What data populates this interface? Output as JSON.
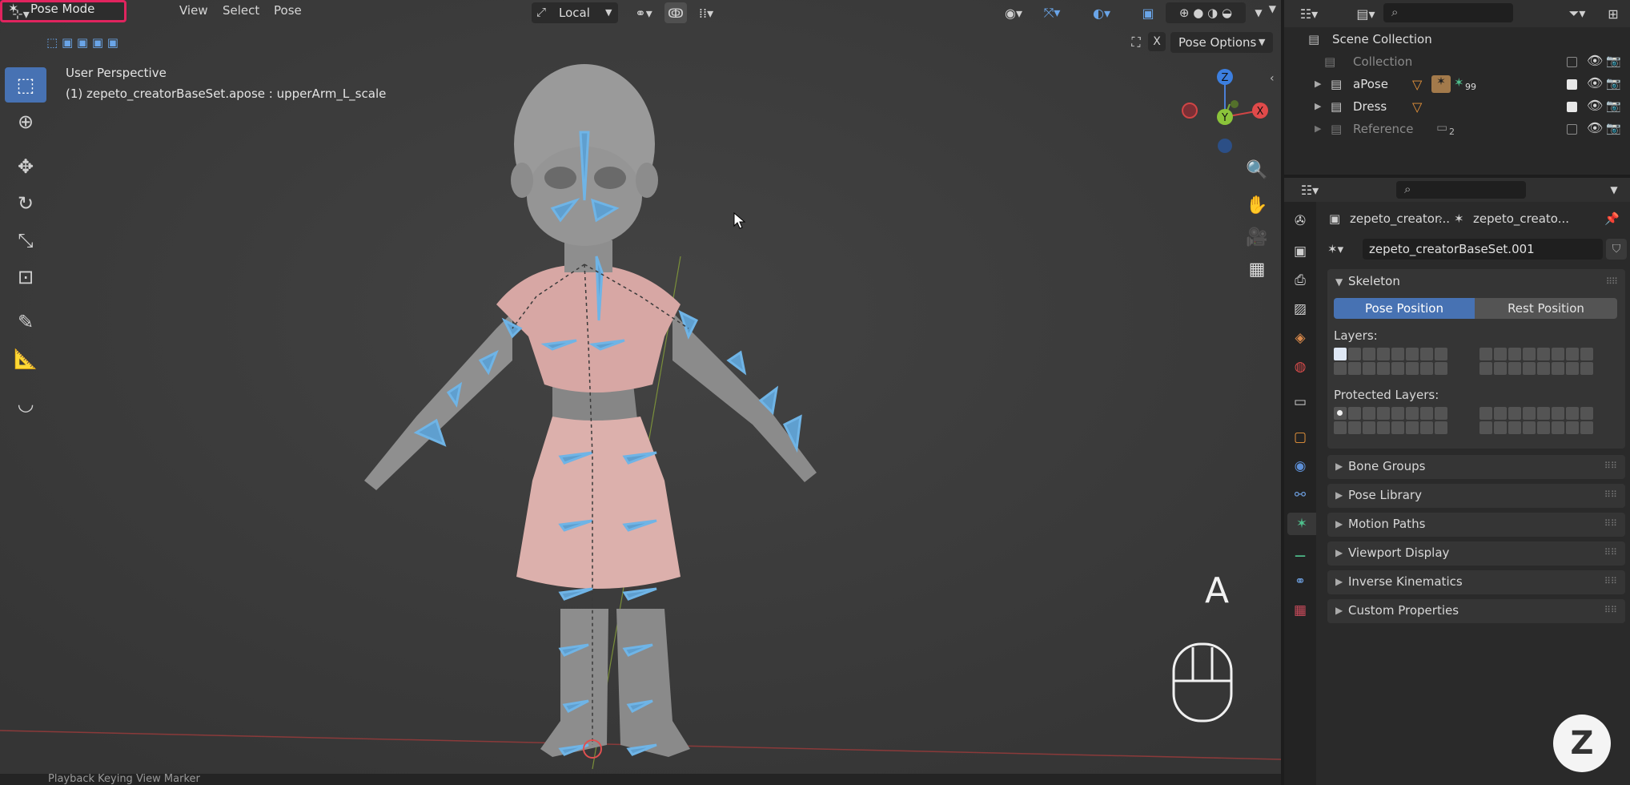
{
  "viewport": {
    "mode": "Pose Mode",
    "menus": [
      "View",
      "Select",
      "Pose"
    ],
    "orientation": "Local",
    "pose_options_label": "Pose Options",
    "close_x": "X",
    "info_line1": "User Perspective",
    "info_line2": "(1) zepeto_creatorBaseSet.apose : upperArm_L_scale",
    "gizmo": {
      "z": "Z",
      "y": "Y",
      "x": "X"
    },
    "key_overlay": "A",
    "timeline_text": "Playback    Keying    View    Marker"
  },
  "outliner": {
    "items": [
      {
        "name": "Scene Collection",
        "level": 0,
        "dim": false,
        "checkbox": false,
        "visible": false
      },
      {
        "name": "Collection",
        "level": 1,
        "dim": true,
        "checkbox": true,
        "checked": false
      },
      {
        "name": "aPose",
        "level": 1,
        "dim": false,
        "checkbox": true,
        "checked": true,
        "badge": "99"
      },
      {
        "name": "Dress",
        "level": 1,
        "dim": false,
        "checkbox": true,
        "checked": true
      },
      {
        "name": "Reference",
        "level": 1,
        "dim": true,
        "checkbox": true,
        "checked": false,
        "badge": "2"
      }
    ]
  },
  "properties": {
    "breadcrumb_1": "zepeto_creator...",
    "breadcrumb_2": "zepeto_creato...",
    "datablock_name": "zepeto_creatorBaseSet.001",
    "skeleton": {
      "title": "Skeleton",
      "pose_position": "Pose Position",
      "rest_position": "Rest Position",
      "layers_label": "Layers:",
      "protected_label": "Protected Layers:"
    },
    "sections": [
      "Bone Groups",
      "Pose Library",
      "Motion Paths",
      "Viewport Display",
      "Inverse Kinematics",
      "Custom Properties"
    ]
  },
  "colors": {
    "accent": "#4772b3",
    "mode_highlight": "#e0245e",
    "bone": "#6fb4e6",
    "dress": "#d9a9a6",
    "body": "#8e8e8e"
  }
}
